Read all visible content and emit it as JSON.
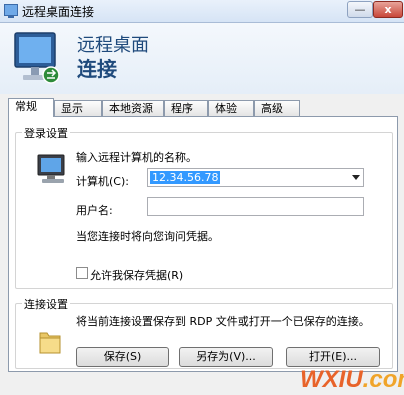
{
  "window": {
    "title": "远程桌面连接",
    "minimize_glyph": "—",
    "close_glyph": "x"
  },
  "header": {
    "line1": "远程桌面",
    "line2": "连接"
  },
  "tabs": [
    {
      "label": "常规",
      "active": true
    },
    {
      "label": "显示",
      "active": false
    },
    {
      "label": "本地资源",
      "active": false
    },
    {
      "label": "程序",
      "active": false
    },
    {
      "label": "体验",
      "active": false
    },
    {
      "label": "高级",
      "active": false
    }
  ],
  "login": {
    "group_title": "登录设置",
    "prompt": "输入远程计算机的名称。",
    "computer_label": "计算机(C):",
    "computer_value": "12.34.56.78",
    "username_label": "用户名:",
    "username_value": "",
    "note": "当您连接时将向您询问凭据。",
    "save_credentials_label": "允许我保存凭据(R)",
    "save_credentials_checked": false
  },
  "connection": {
    "group_title": "连接设置",
    "description": "将当前连接设置保存到 RDP 文件或打开一个已保存的连接。",
    "save_label": "保存(S)",
    "save_as_label": "另存为(V)...",
    "open_label": "打开(E)..."
  },
  "watermark": {
    "part1": "WXIU",
    "part2": ".com"
  },
  "colors": {
    "header_text": "#1f4a7c",
    "selection": "#3399ff",
    "close_button": "#c8473a"
  }
}
